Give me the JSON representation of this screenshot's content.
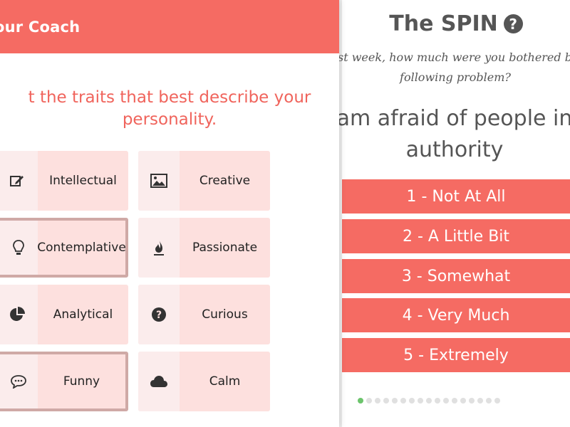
{
  "coach": {
    "header_title": "our Coach",
    "prompt_line1": "t the traits that best describe your",
    "prompt_line2": "personality.",
    "traits": [
      {
        "label": "Intellectual",
        "icon": "edit-icon",
        "selected": false
      },
      {
        "label": "Creative",
        "icon": "image-icon",
        "selected": false
      },
      {
        "label": "Contemplative",
        "icon": "lightbulb-icon",
        "selected": true
      },
      {
        "label": "Passionate",
        "icon": "flame-icon",
        "selected": false
      },
      {
        "label": "Analytical",
        "icon": "pie-chart-icon",
        "selected": false
      },
      {
        "label": "Curious",
        "icon": "question-circle-icon",
        "selected": false
      },
      {
        "label": "Funny",
        "icon": "speech-bubble-icon",
        "selected": true
      },
      {
        "label": "Calm",
        "icon": "cloud-icon",
        "selected": false
      }
    ]
  },
  "spin": {
    "title": "The SPIN",
    "help_glyph": "?",
    "question_line1": "st week, how much were you bothered by",
    "question_line2": "following problem?",
    "problem_line1": "am afraid of people in",
    "problem_line2": "authority",
    "options": [
      "1 - Not At All",
      "2 - A Little Bit",
      "3 - Somewhat",
      "4 - Very Much",
      "5 - Extremely"
    ],
    "pagination": {
      "total": 17,
      "current": 1
    }
  },
  "colors": {
    "accent": "#f56b63",
    "trait_bg": "#fde0de",
    "progress_active": "#6cc46c"
  }
}
